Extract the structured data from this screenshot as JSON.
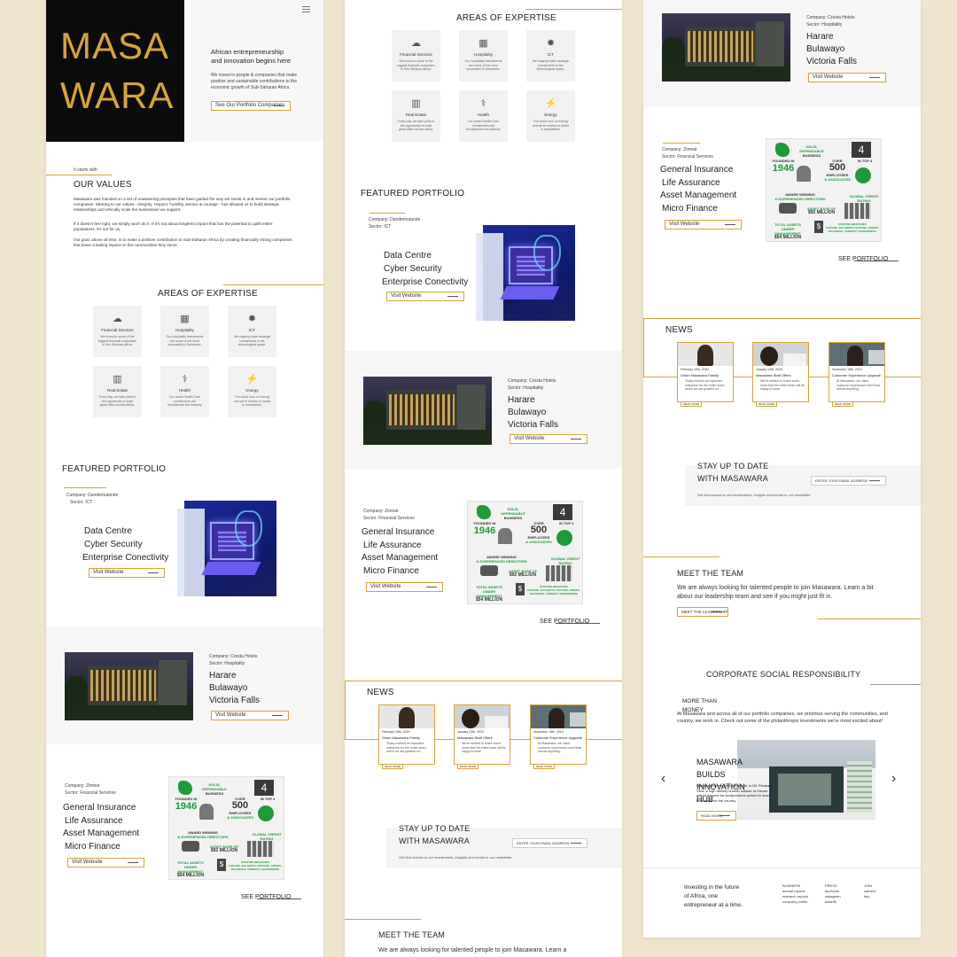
{
  "brand": {
    "line1": "MASA",
    "line2": "WARA",
    "bg": "#0b0b0b",
    "gold": "#d8a436"
  },
  "hero": {
    "heading": "African entrepreneurship and innovation begins here",
    "text": "We invest in people & companies that make positive and sustainable contributions to the economic growth of Sub-Saharan Africa.",
    "cta": "See Our Portfolio Companies"
  },
  "values": {
    "kicker": "It starts with",
    "title": "OUR VALUES",
    "p1": "Masawara was founded on a set of unwavering principles that have guided the way we invest in and mentor our portfolio companies. Sticking to our values - integrity, respect, humility, service & courage - has allowed us to build strategic relationships and ethically scale the businesses we support.",
    "p2": "If it doesn't feel right, we simply won't do it. If it's not about longterm impact that has the potential to uplift entire populations, it's not for us.",
    "p3": "Our goal, above all else, is to make a positive contribution to Sub-Saharan Africa by creating financially strong companies that leave a lasting impact on the communities they serve."
  },
  "expertise": {
    "title": "AREAS OF EXPERTISE",
    "items": [
      {
        "icon": "financial-services-icon",
        "glyph": "☁",
        "label": "Financial Services",
        "desc": "We invest in some of the biggest financial companies in Sub-Saharan Africa."
      },
      {
        "icon": "hospitality-icon",
        "glyph": "▦",
        "label": "Hospitality",
        "desc": "Our hospitality investments are some of the most successful in Zimbabwe."
      },
      {
        "icon": "ict-icon",
        "glyph": "✹",
        "label": "ICT",
        "desc": "We eagerly make strategic investments in the technological space."
      },
      {
        "icon": "real-estate-icon",
        "glyph": "▥",
        "label": "Real Estate",
        "desc": "Every day, we take pride in the opportunity to build great office across Africa."
      },
      {
        "icon": "health-icon",
        "glyph": "⚕",
        "label": "Health",
        "desc": "Our smart Health Care investments will revolutionize the industry."
      },
      {
        "icon": "energy-icon",
        "glyph": "⚡",
        "label": "Energy",
        "desc": "The world runs on energy and we're excited to invest in renewables."
      }
    ]
  },
  "portfolio": {
    "title": "FEATURED PORTFOLIO",
    "see_all": "SEE PORTFOLIO",
    "visit": "Visit Website",
    "items": [
      {
        "company": "Company: Dandemutande",
        "sector": "Sector: ICT",
        "services": [
          "Data Centre",
          "Cyber Security",
          "Enterprise Conectivity"
        ]
      },
      {
        "company": "Company: Cresta Hotels",
        "sector": "Sector: Hospitality",
        "services": [
          "Harare",
          "Bulawayo",
          "Victoria Falls"
        ]
      },
      {
        "company": "Company: Zimnat",
        "sector": "Sector: Financial Services",
        "services": [
          "General Insurance",
          "Life Assurance",
          "Asset Management",
          "Micro Finance"
        ]
      }
    ]
  },
  "zimnat_info": {
    "solid1": "SOLID,",
    "solid2": "DEPENDABLE",
    "solid3": "BUSINESS",
    "founded": "FOUNDED IN",
    "year": "1946",
    "over": "OVER",
    "employees": "500",
    "emp2": "EMPLOYEES",
    "emp3": "& ASSOCIATES",
    "intop": "IN TOP 4",
    "award": "AWARD WINNING",
    "award2": "& EXPERIENCED DIRECTORS",
    "credit": "GLOBAL CREDIT",
    "credit2": "RATING",
    "asset": "ASSET BASE OF",
    "assetv": "$92 MILLION",
    "total": "TOTAL ASSETS",
    "total2": "UNDER MANAGEMENT",
    "totalv": "$54 MILLION",
    "existing": "EXISTING BRANCHES",
    "cities": "HARARE, BULAWAYO, MUTARE, GWERU, MASVINGO, CHINHOYI, MARONDERA"
  },
  "news": {
    "title": "NEWS",
    "read": "READ MORE",
    "items": [
      {
        "date": "February 19th, 2020",
        "head": "Gwen Masawara Family",
        "body": "Today marked an important milestone for the entire team, which we are grateful for..."
      },
      {
        "date": "January 12th, 2020",
        "head": "Masawara Staff Offers",
        "body": "We're excited to share some news that the entire team will be happy to hear!"
      },
      {
        "date": "November 15th, 2019",
        "head": "Customer Experience Upgrade",
        "body": "At Masawara, we value customer experience more than almost anything..."
      }
    ]
  },
  "newsletter": {
    "title1": "STAY UP TO DATE",
    "title2": "WITH MASAWARA",
    "placeholder": "ENTER YOUR EMAIL ADDRESS",
    "sub": "Get first access to our investments, insights and trends in our newsletter."
  },
  "team": {
    "title": "MEET THE TEAM",
    "text": "We are always looking for talented people to join Masawara. Learn a bit about our leadership team and see if you might just fit in.",
    "text_cut": "We are always looking for talented people to join Masawara. Learn a",
    "cta": "MEET THE LEADERSHIP"
  },
  "csr": {
    "title": "CORPORATE SOCIAL RESPONSIBILITY",
    "more": "MORE THAN MONEY",
    "text": "At Masawara and across all of our portfolio companies, we prioritize serving the communities, and country, we work in. Check out some of the philanthropic investments we're most excited about!",
    "slide_title": "MASAWARA BUILDS INNOVATION HUB",
    "slide_text": "Masawara's new innovation hub, in Mt. Pleasant View, a high density suburb outside of Harare will be a home for techpreneurs poised to leave their mark on the country.",
    "read": "READ MORE"
  },
  "footer": {
    "tagline": "Investing in the future of Africa, one entrepreneur at a time.",
    "cols": [
      {
        "h": "BUSINESS",
        "items": [
          "annual reports",
          "research reports",
          "company profile"
        ]
      },
      {
        "h": "PRESS",
        "items": [
          "facebook",
          "instagram",
          "awards"
        ]
      },
      {
        "h": "JOIN",
        "items": [
          "careers",
          "faq"
        ]
      }
    ]
  }
}
